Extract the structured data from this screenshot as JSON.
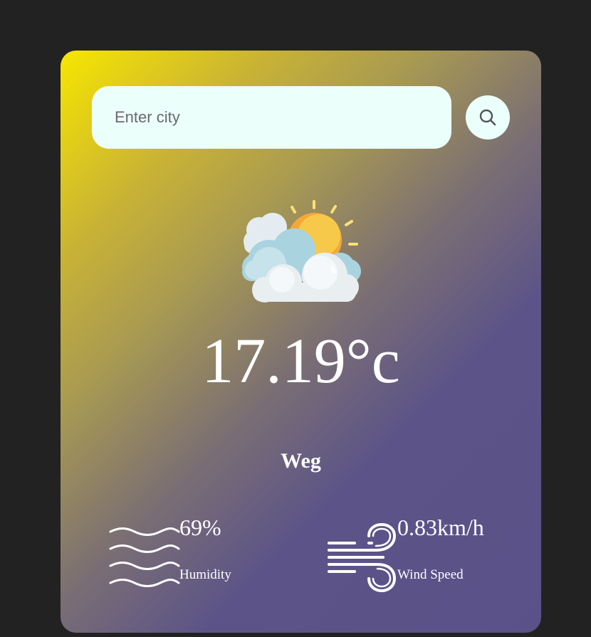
{
  "search": {
    "placeholder": "Enter city"
  },
  "icons": {
    "search": "search-icon",
    "weather": "partly-cloudy-sun-icon",
    "humidity": "humidity-waves-icon",
    "wind": "wind-icon"
  },
  "weather": {
    "temperature": "17.19°c",
    "city": "Weg"
  },
  "humidity": {
    "value": "69%",
    "label": "Humidity"
  },
  "wind": {
    "value": "0.83km/h",
    "label": "Wind Speed"
  },
  "colors": {
    "page_background": "#222222",
    "gradient_start": "#f7e600",
    "gradient_end": "#5a5189",
    "input_background": "#ebfffb"
  }
}
